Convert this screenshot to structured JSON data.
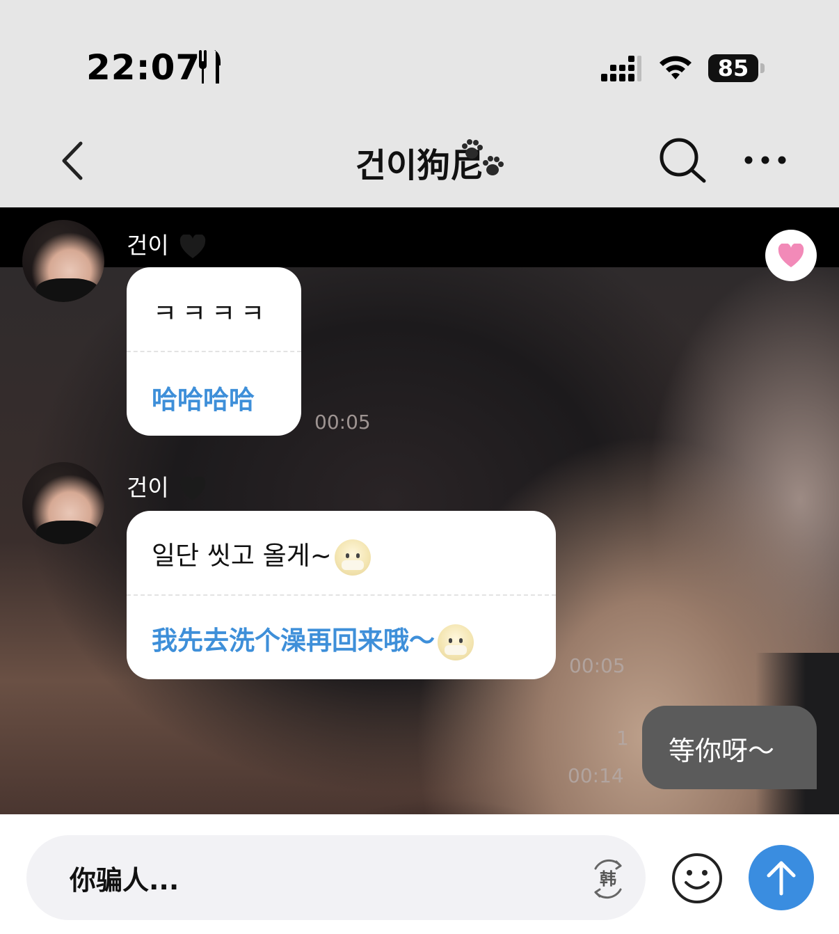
{
  "status_bar": {
    "time": "22:07",
    "battery": "85"
  },
  "nav": {
    "title": "건이狗尼"
  },
  "messages": [
    {
      "sender": "건이",
      "original": "ㅋㅋㅋㅋ",
      "translation": "哈哈哈哈",
      "time": "00:05"
    },
    {
      "sender": "건이",
      "original": "일단 씻고 올게~",
      "translation": "我先去洗个澡再回来哦～",
      "time": "00:05"
    }
  ],
  "my_message": {
    "text": "等你呀～",
    "read_count": "1",
    "time": "00:14"
  },
  "input": {
    "value": "你骗人..."
  },
  "colors": {
    "translation_blue": "#3e8fd9",
    "send_button": "#3a8de0",
    "my_bubble": "#5b5b5b",
    "like_heart": "#f28ab8"
  }
}
